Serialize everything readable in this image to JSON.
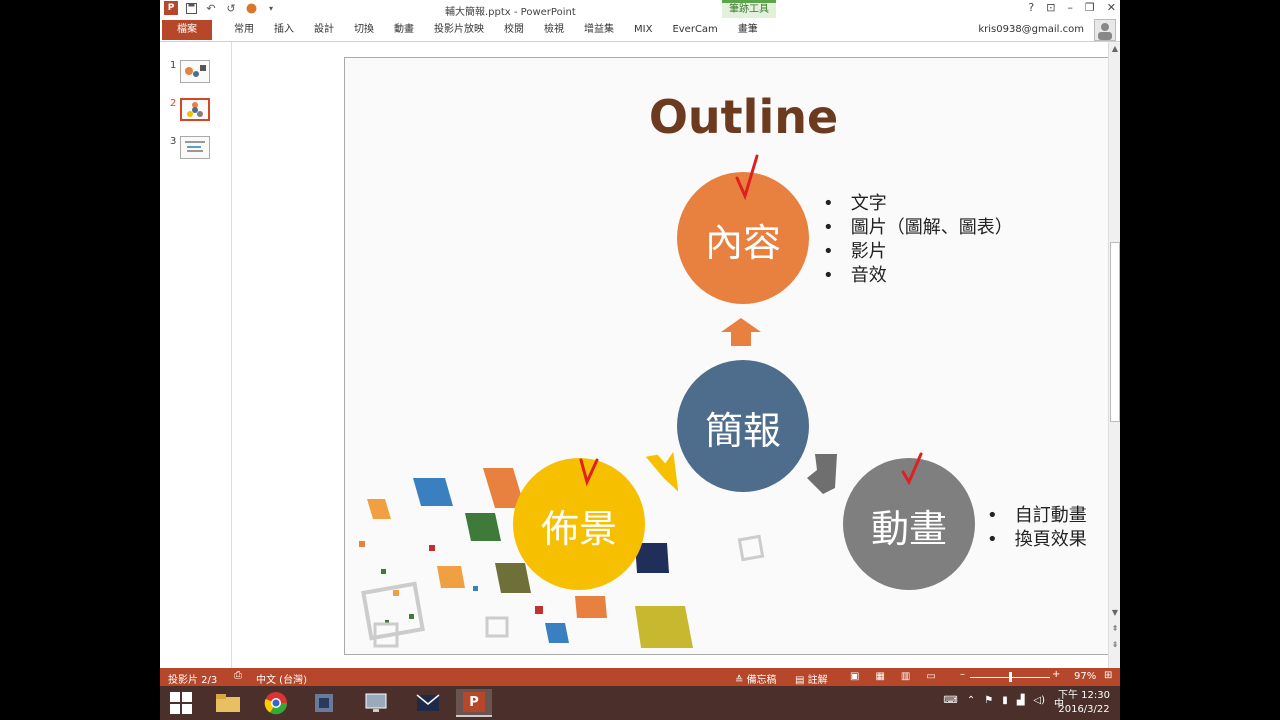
{
  "window": {
    "title": "輔大簡報.pptx - PowerPoint",
    "context_tab": "筆跡工具",
    "help": "?"
  },
  "ribbon": {
    "file_tab": "檔案",
    "tabs": [
      "常用",
      "插入",
      "設計",
      "切換",
      "動畫",
      "投影片放映",
      "校閱",
      "檢視",
      "增益集",
      "MIX",
      "EverCam",
      "畫筆"
    ],
    "account": "kris0938@gmail.com"
  },
  "thumbnails": [
    {
      "num": "1",
      "selected": false
    },
    {
      "num": "2",
      "selected": true
    },
    {
      "num": "3",
      "selected": false
    }
  ],
  "slide": {
    "title": "Outline",
    "circles": {
      "center": "簡報",
      "top": "內容",
      "left": "佈景",
      "right": "動畫"
    },
    "content_bullets": [
      "文字",
      "圖片（圖解、圖表）",
      "影片",
      "音效"
    ],
    "animation_bullets": [
      "自訂動畫",
      "換頁效果"
    ],
    "colors": {
      "title": "#6b3a1f",
      "top": "#e8803f",
      "center": "#4e6d8c",
      "left": "#f6c000",
      "right": "#7f7f7f",
      "check": "#e02020"
    }
  },
  "status": {
    "slide_indicator": "投影片 2/3",
    "language": "中文 (台灣)",
    "notes": "備忘稿",
    "comments": "註解",
    "zoom": "97%",
    "zoom_level": 0.5
  },
  "taskbar": {
    "ime": "中",
    "time": "下午 12:30",
    "date": "2016/3/22"
  }
}
